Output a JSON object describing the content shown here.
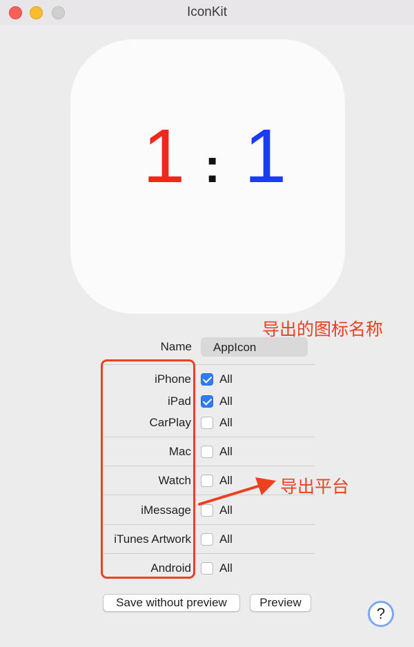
{
  "window": {
    "title": "IconKit"
  },
  "preview": {
    "left": "1",
    "colon": ":",
    "right": "1",
    "left_color": "#f3261b",
    "right_color": "#1b3cf5"
  },
  "name_field": {
    "label": "Name",
    "value": "AppIcon"
  },
  "platforms": [
    {
      "label": "iPhone",
      "all_label": "All",
      "checked": true
    },
    {
      "label": "iPad",
      "all_label": "All",
      "checked": true
    },
    {
      "label": "CarPlay",
      "all_label": "All",
      "checked": false
    },
    {
      "label": "Mac",
      "all_label": "All",
      "checked": false
    },
    {
      "label": "Watch",
      "all_label": "All",
      "checked": false
    },
    {
      "label": "iMessage",
      "all_label": "All",
      "checked": false
    },
    {
      "label": "iTunes Artwork",
      "all_label": "All",
      "checked": false
    },
    {
      "label": "Android",
      "all_label": "All",
      "checked": false
    }
  ],
  "annotations": {
    "name_note": "导出的图标名称",
    "platform_note": "导出平台",
    "color": "#ec4020"
  },
  "buttons": {
    "save_without_preview": "Save without preview",
    "preview": "Preview",
    "help": "?"
  }
}
